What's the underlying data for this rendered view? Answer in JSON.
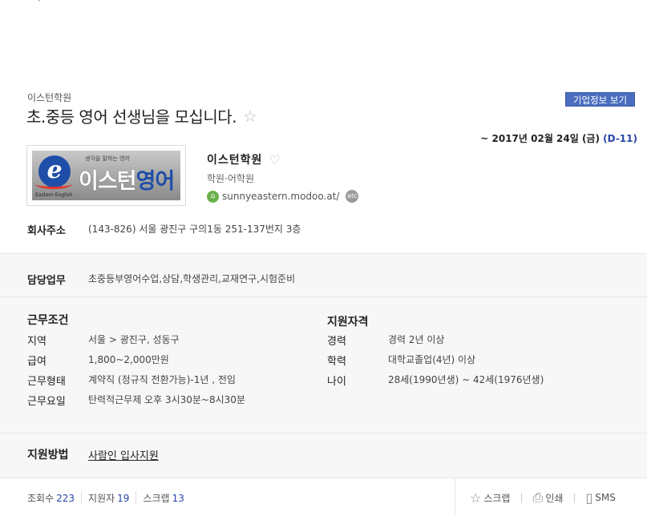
{
  "header": {
    "company_small": "이스턴학원",
    "title": "초.중등 영어 선생님을 모십니다.",
    "corp_info_button": "기업정보 보기",
    "deadline_text": "~ 2017년 02월 24일 (금)",
    "dday": "(D-11)"
  },
  "logo": {
    "tagline": "생각을 말하는 영어",
    "name_prefix": "이스턴",
    "name_accent": "영어",
    "english": "Eastern English"
  },
  "company": {
    "name": "이스턴학원",
    "category": "학원·어학원",
    "url": "sunnyeastern.modoo.at/",
    "etc": "etc"
  },
  "address": {
    "label": "회사주소",
    "value": "(143-826) 서울 광진구 구의1동 251-137번지 3층"
  },
  "duty": {
    "label": "담당업무",
    "value": "초중등부영어수업,상담,학생관리,교재연구,시험준비"
  },
  "conditions": {
    "title": "근무조건",
    "rows": [
      {
        "label": "지역",
        "value": "서울 > 광진구, 성동구"
      },
      {
        "label": "급여",
        "value": "1,800~2,000만원"
      },
      {
        "label": "근무형태",
        "value": "계약직 (정규직 전환가능)-1년 , 전임"
      },
      {
        "label": "근무요일",
        "value": "탄력적근무제 오후 3시30분~8시30분"
      }
    ]
  },
  "qualifications": {
    "title": "지원자격",
    "rows": [
      {
        "label": "경력",
        "value": "경력 2년 이상"
      },
      {
        "label": "학력",
        "value": "대학교졸업(4년) 이상"
      },
      {
        "label": "나이",
        "value": "28세(1990년생) ~ 42세(1976년생)"
      }
    ]
  },
  "apply": {
    "label": "지원방법",
    "link": "사람인 입사지원"
  },
  "footer": {
    "views_label": "조회수",
    "views": "223",
    "applicants_label": "지원자",
    "applicants": "19",
    "scraps_label": "스크랩",
    "scraps": "13",
    "scrap_button": "스크랩",
    "print_button": "인쇄",
    "sms_button": "SMS"
  }
}
